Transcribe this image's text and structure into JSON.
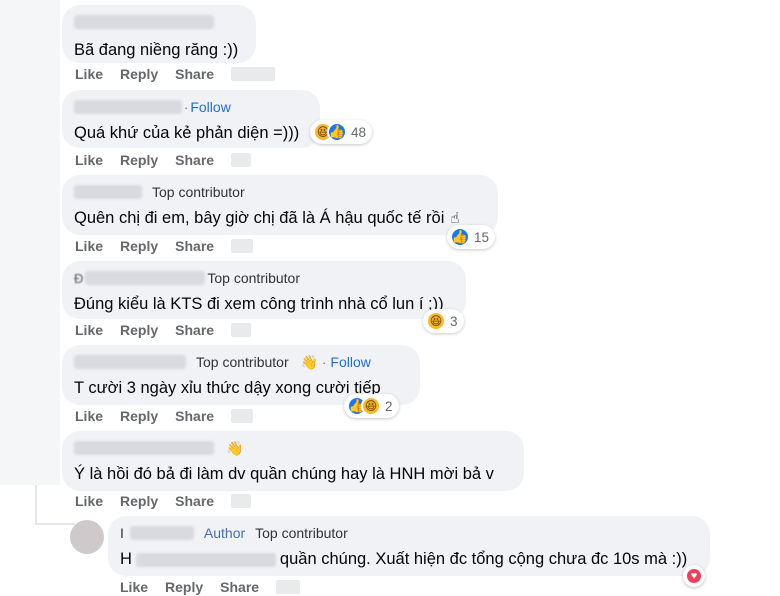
{
  "actions": {
    "like": "Like",
    "reply": "Reply",
    "share": "Share"
  },
  "comments": [
    {
      "text": "Bã đang niềng răng :))"
    },
    {
      "follow": "Follow",
      "dot": "·",
      "text": "Quá khứ của kẻ phản diện =)))",
      "reaction_count": "48"
    },
    {
      "badge": "Top contributor",
      "text": "Quên chị đi em, bây giờ chị đã là Á hậu quốc tế rồi",
      "reaction_count": "15"
    },
    {
      "name_fragment": "Đ",
      "badge": "Top contributor",
      "text": "Đúng kiểu là KTS đi xem công trình nhà cổ lun í ;))",
      "reaction_count": "3"
    },
    {
      "badge": "Top contributor",
      "follow": "Follow",
      "dot": "·",
      "text": "T cười 3 ngày xỉu thức dậy xong cười tiếp",
      "reaction_count": "2"
    },
    {
      "text": "Ý là hồi đó bả đi làm dv quần chúng hay là HNH mời bả v"
    },
    {
      "author": "Author",
      "badge": "Top contributor",
      "name_fragment": "I",
      "text_prefix": "H",
      "text": "quần chúng. Xuất hiện đc tổng cộng chưa đc 10s mà :))"
    }
  ],
  "icons": {
    "like": "thumbs-up-icon",
    "haha": "haha-icon",
    "love": "love-icon",
    "hand": "waving-hand-icon",
    "finger": "pointing-finger-icon"
  },
  "colors": {
    "bubble": "#f0f2f5",
    "follow": "#216fdb",
    "like": "#1877f2",
    "haha": "#f7b928",
    "love": "#f33e58"
  }
}
